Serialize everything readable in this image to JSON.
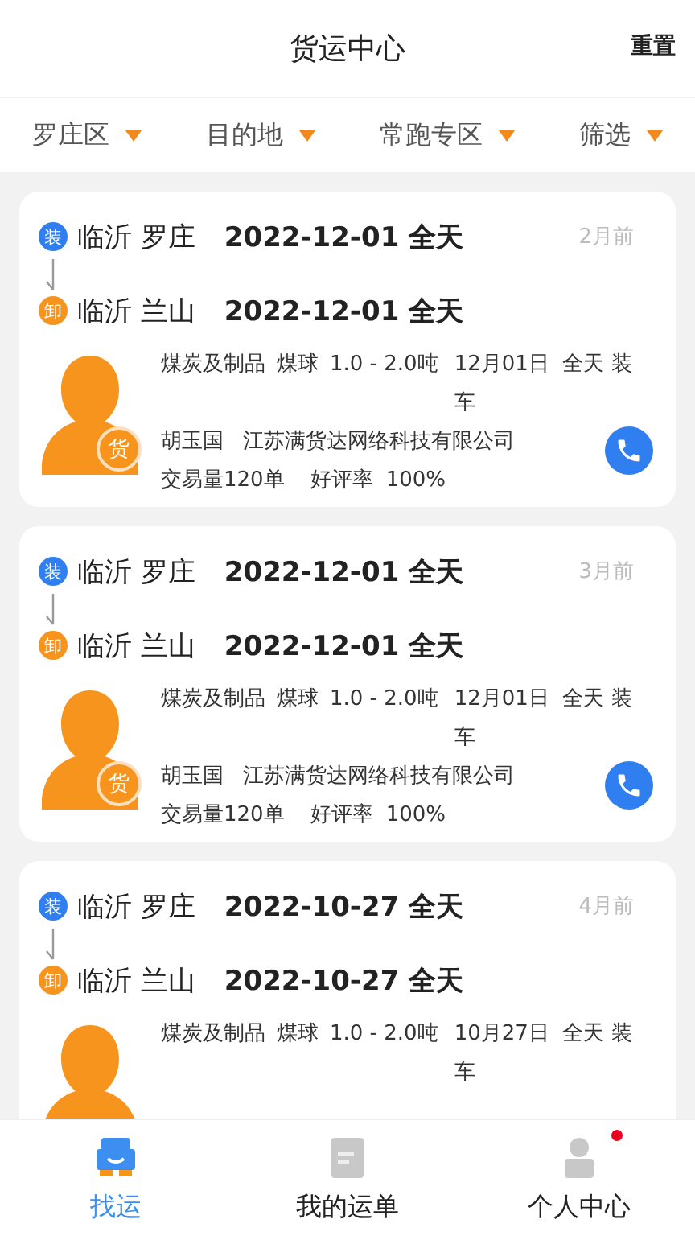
{
  "header": {
    "title": "货运中心",
    "action": "重置"
  },
  "filters": [
    {
      "label": "罗庄区"
    },
    {
      "label": "目的地"
    },
    {
      "label": "常跑专区"
    },
    {
      "label": "筛选"
    }
  ],
  "cards": [
    {
      "stops": [
        {
          "kind": "load",
          "badge": "装",
          "place": "临沂 罗庄",
          "date": "2022-12-01 全天"
        },
        {
          "kind": "unload",
          "badge": "卸",
          "place": "临沂 兰山",
          "date": "2022-12-01 全天"
        }
      ],
      "age": "2月前",
      "avatar_badge": "货",
      "goods": [
        "煤炭及制品",
        "煤球",
        "1.0 - 2.0吨"
      ],
      "schedule": "12月01日  全天 装车",
      "owner": "胡玉国",
      "company": "江苏满货达网络科技有限公司",
      "trades": "交易量120单",
      "rating_label": "好评率",
      "rating": "100%"
    },
    {
      "stops": [
        {
          "kind": "load",
          "badge": "装",
          "place": "临沂 罗庄",
          "date": "2022-12-01 全天"
        },
        {
          "kind": "unload",
          "badge": "卸",
          "place": "临沂 兰山",
          "date": "2022-12-01 全天"
        }
      ],
      "age": "3月前",
      "avatar_badge": "货",
      "goods": [
        "煤炭及制品",
        "煤球",
        "1.0 - 2.0吨"
      ],
      "schedule": "12月01日  全天 装车",
      "owner": "胡玉国",
      "company": "江苏满货达网络科技有限公司",
      "trades": "交易量120单",
      "rating_label": "好评率",
      "rating": "100%"
    },
    {
      "stops": [
        {
          "kind": "load",
          "badge": "装",
          "place": "临沂 罗庄",
          "date": "2022-10-27 全天"
        },
        {
          "kind": "unload",
          "badge": "卸",
          "place": "临沂 兰山",
          "date": "2022-10-27 全天"
        }
      ],
      "age": "4月前",
      "goods": [
        "煤炭及制品",
        "煤球",
        "1.0 - 2.0吨"
      ],
      "schedule": "10月27日  全天 装车"
    }
  ],
  "tabs": [
    {
      "kind": "find",
      "label": "找运",
      "selected": true,
      "dot": false
    },
    {
      "kind": "orders",
      "label": "我的运单",
      "selected": false,
      "dot": false
    },
    {
      "kind": "profile",
      "label": "个人中心",
      "selected": false,
      "dot": true
    }
  ]
}
